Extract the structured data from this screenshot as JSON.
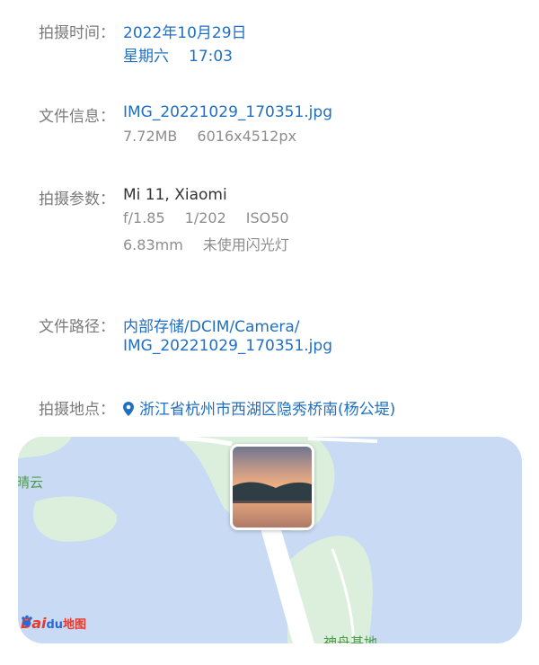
{
  "capture_time": {
    "label": "拍摄时间：",
    "date": "2022年10月29日",
    "weekday": "星期六",
    "time": "17:03"
  },
  "file_info": {
    "label": "文件信息：",
    "filename": "IMG_20221029_170351.jpg",
    "size": "7.72MB",
    "resolution": "6016x4512px"
  },
  "capture_params": {
    "label": "拍摄参数：",
    "device": "Mi 11, Xiaomi",
    "aperture": "f/1.85",
    "shutter": "1/202",
    "iso": "ISO50",
    "focal_length": "6.83mm",
    "flash": "未使用闪光灯"
  },
  "file_path": {
    "label": "文件路径：",
    "line1": "内部存储/DCIM/Camera/",
    "line2": "IMG_20221029_170351.jpg"
  },
  "location": {
    "label": "拍摄地点：",
    "icon": "location-pin-icon",
    "address": "浙江省杭州市西湖区隐秀桥南(杨公堤)"
  },
  "map": {
    "label_left": "晴云",
    "label_bottom": "神舟基地",
    "logo_part1": "Bai",
    "logo_part2": "du",
    "logo_part3": "地图",
    "colors": {
      "water": "#c8daf4",
      "land": "#dcefdc",
      "road": "#ffffff"
    }
  },
  "colors": {
    "link": "#1f6fc3",
    "label": "#7a7a7a",
    "secondary": "#8d8d8d"
  }
}
